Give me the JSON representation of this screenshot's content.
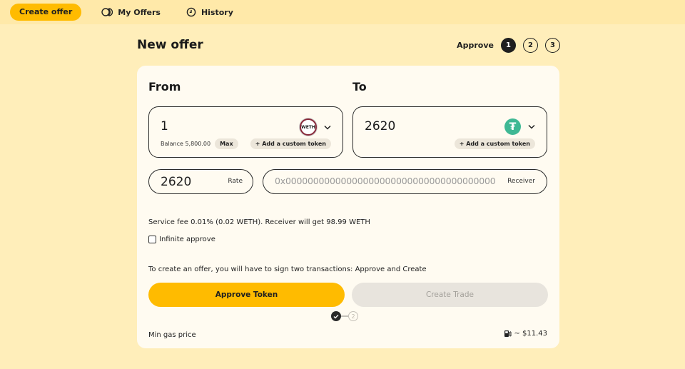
{
  "nav": {
    "create_label": "Create offer",
    "my_offers_label": "My Offers",
    "history_label": "History"
  },
  "page": {
    "title": "New offer",
    "steps_label": "Approve",
    "steps": [
      "1",
      "2",
      "3"
    ]
  },
  "from": {
    "label": "From",
    "amount": "1",
    "token_symbol": "WETH",
    "balance": "Balance 5,800.00",
    "max_label": "Max",
    "custom_token_label": "+ Add a custom token"
  },
  "to": {
    "label": "To",
    "amount": "2620",
    "token_symbol": "USDT",
    "custom_token_label": "+ Add a custom token"
  },
  "rate": {
    "value": "2620",
    "label": "Rate"
  },
  "receiver": {
    "placeholder": "0x0000000000000000000000000000000000000000",
    "label": "Receiver"
  },
  "fee_text": "Service fee 0.01% (0.02 WETH). Receiver will get 98.99 WETH",
  "infinite_approve_label": "Infinite approve",
  "info_text": "To create an offer, you will have to sign two transactions: Approve and Create",
  "buttons": {
    "approve_label": "Approve Token",
    "create_label": "Create Trade"
  },
  "progress": {
    "step_two": "2"
  },
  "gas": {
    "label": "Min gas price",
    "value": "~ $11.43"
  },
  "colors": {
    "background": "#ffeeba",
    "accent": "#ffbb00",
    "card": "#fffbf1",
    "disabled": "#e8e4dd",
    "usdt": "#3fb894"
  }
}
